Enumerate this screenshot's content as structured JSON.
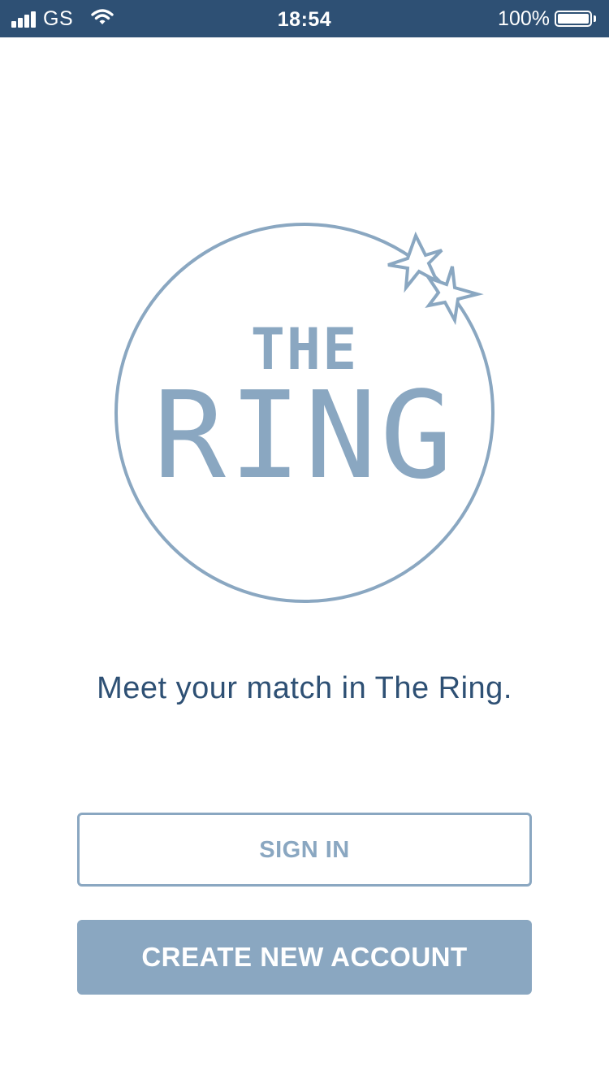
{
  "status_bar": {
    "carrier": "GS",
    "time": "18:54",
    "battery_percent": "100%",
    "battery_level": 1.0,
    "icons": [
      "signal-bars-icon",
      "wifi-icon",
      "battery-icon"
    ]
  },
  "logo": {
    "line1": "THE",
    "line2": "RING",
    "icons": [
      "ring-circle",
      "sparkle-star-icon"
    ]
  },
  "tagline": "Meet your match in The Ring.",
  "buttons": {
    "sign_in": "SIGN IN",
    "create_account": "CREATE NEW ACCOUNT"
  },
  "colors": {
    "status_bar_bg": "#2e5074",
    "accent": "#8aa7c1",
    "text_dark": "#2e5074",
    "background": "#ffffff"
  }
}
